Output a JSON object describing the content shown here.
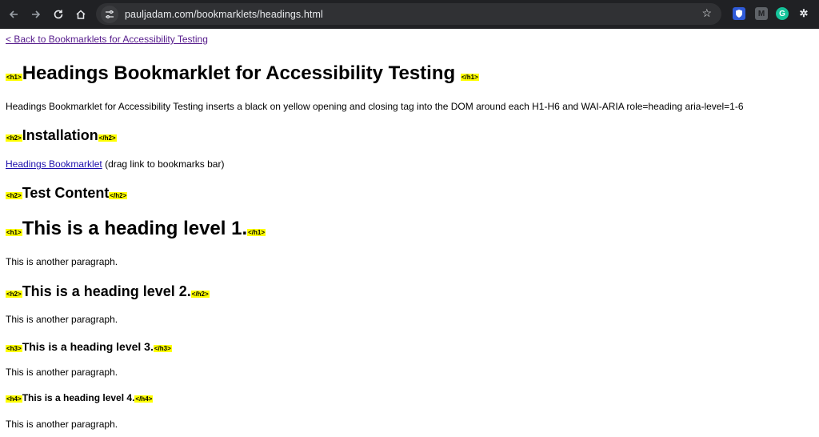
{
  "browser": {
    "url": "pauljadam.com/bookmarklets/headings.html",
    "icons": [
      "back-icon",
      "forward-icon",
      "reload-icon",
      "home-icon",
      "site-info-icon",
      "bookmark-star-icon",
      "extension-shield-icon",
      "extension-m-icon",
      "extension-grammarly-icon",
      "extension-puzzle-icon"
    ]
  },
  "page": {
    "back_link": "< Back to Bookmarklets for Accessibility Testing",
    "h1_open": "<h1>",
    "h1_close": "</h1>",
    "h2_open": "<h2>",
    "h2_close": "</h2>",
    "h3_open": "<h3>",
    "h3_close": "</h3>",
    "h4_open": "<h4>",
    "h4_close": "</h4>",
    "title": "Headings Bookmarklet for Accessibility Testing",
    "intro": "Headings Bookmarklet for Accessibility Testing inserts a black on yellow opening and closing tag into the DOM around each H1-H6 and WAI-ARIA role=heading aria-level=1-6",
    "installation_heading": "Installation",
    "bookmarklet_link": "Headings Bookmarklet",
    "bookmarklet_hint": " (drag link to bookmarks bar)",
    "test_content_heading": "Test Content",
    "heading_level_1": "This is a heading level 1.",
    "heading_level_2": "This is a heading level 2.",
    "heading_level_3": "This is a heading level 3.",
    "heading_level_4": "This is a heading level 4.",
    "paragraph": "This is another paragraph."
  }
}
